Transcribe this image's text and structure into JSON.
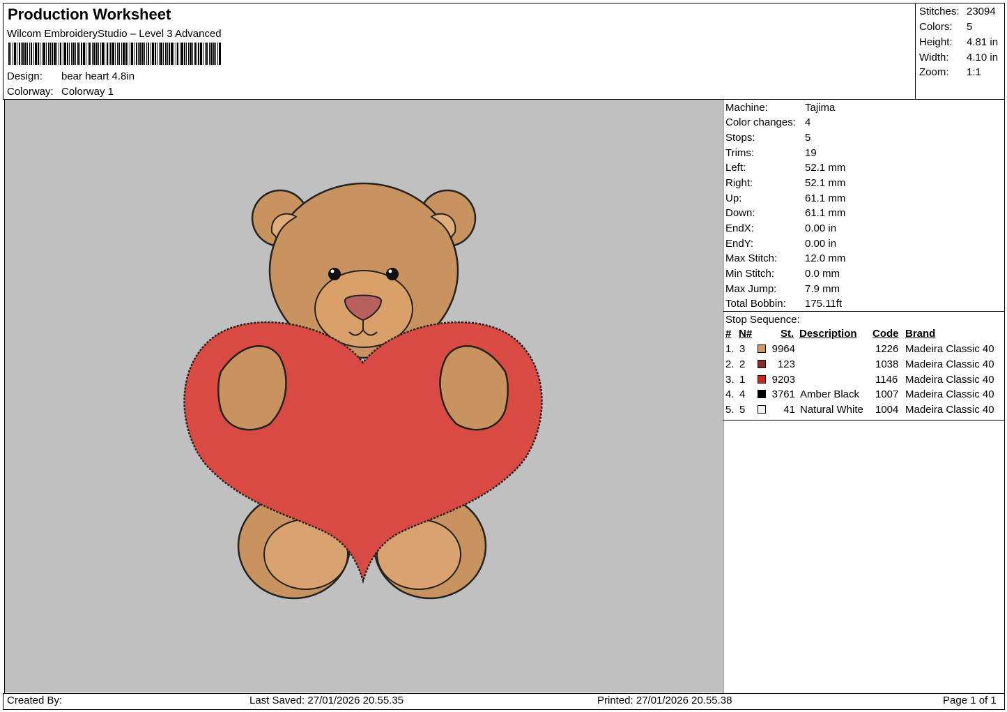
{
  "header": {
    "title": "Production Worksheet",
    "subtitle": "Wilcom EmbroideryStudio – Level 3 Advanced",
    "design_label": "Design:",
    "design_value": "bear heart 4.8in",
    "colorway_label": "Colorway:",
    "colorway_value": "Colorway 1"
  },
  "stats": [
    {
      "label": "Stitches:",
      "value": "23094"
    },
    {
      "label": "Colors:",
      "value": "5"
    },
    {
      "label": "Height:",
      "value": "4.81 in"
    },
    {
      "label": "Width:",
      "value": "4.10 in"
    },
    {
      "label": "Zoom:",
      "value": "1:1"
    }
  ],
  "info": [
    {
      "label": "Machine:",
      "value": "Tajima"
    },
    {
      "label": "Color changes:",
      "value": "4"
    },
    {
      "label": "Stops:",
      "value": "5"
    },
    {
      "label": "Trims:",
      "value": "19"
    },
    {
      "label": "Left:",
      "value": "52.1 mm"
    },
    {
      "label": "Right:",
      "value": "52.1 mm"
    },
    {
      "label": "Up:",
      "value": "61.1 mm"
    },
    {
      "label": "Down:",
      "value": "61.1 mm"
    },
    {
      "label": "EndX:",
      "value": "0.00 in"
    },
    {
      "label": "EndY:",
      "value": "0.00 in"
    },
    {
      "label": "Max Stitch:",
      "value": "12.0 mm"
    },
    {
      "label": "Min Stitch:",
      "value": "0.0 mm"
    },
    {
      "label": "Max Jump:",
      "value": "7.9 mm"
    },
    {
      "label": "Total Bobbin:",
      "value": "175.11ft"
    }
  ],
  "sequence": {
    "title": "Stop Sequence:",
    "headers": {
      "num": "#",
      "n": "N#",
      "st": "St.",
      "description": "Description",
      "code": "Code",
      "brand": "Brand"
    },
    "rows": [
      {
        "num": "1.",
        "n": "3",
        "color": "#d4956a",
        "st": "9964",
        "description": "",
        "code": "1226",
        "brand": "Madeira Classic 40"
      },
      {
        "num": "2.",
        "n": "2",
        "color": "#8e2a2a",
        "st": "123",
        "description": "",
        "code": "1038",
        "brand": "Madeira Classic 40"
      },
      {
        "num": "3.",
        "n": "1",
        "color": "#d42020",
        "st": "9203",
        "description": "",
        "code": "1146",
        "brand": "Madeira Classic 40"
      },
      {
        "num": "4.",
        "n": "4",
        "color": "#000000",
        "st": "3761",
        "description": "Amber Black",
        "code": "1007",
        "brand": "Madeira Classic 40"
      },
      {
        "num": "5.",
        "n": "5",
        "color": "#f0f0f0",
        "st": "41",
        "description": "Natural White",
        "code": "1004",
        "brand": "Madeira Classic 40"
      }
    ]
  },
  "footer": {
    "created_by": "Created By:",
    "last_saved": "Last Saved: 27/01/2026 20.55.35",
    "printed": "Printed: 27/01/2026 20.55.38",
    "page": "Page 1 of 1"
  },
  "colors": {
    "canvas_bg": "#c0c0c0",
    "bear_fur": "#c9935f",
    "heart": "#d84a42",
    "outline": "#222222",
    "nose": "#b86060"
  }
}
